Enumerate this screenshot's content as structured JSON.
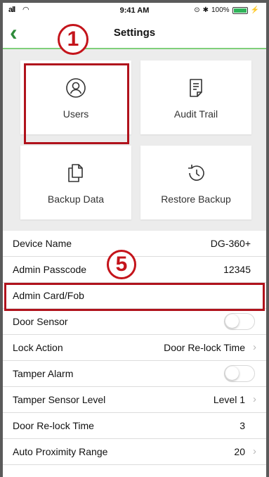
{
  "status": {
    "time": "9:41 AM",
    "signal": "all",
    "battery": "100%"
  },
  "nav": {
    "title": "Settings",
    "back_icon": "chevron-left-icon"
  },
  "annotations": {
    "one": "1",
    "five": "5"
  },
  "tiles": [
    {
      "label": "Users",
      "icon": "user-icon"
    },
    {
      "label": "Audit Trail",
      "icon": "document-icon"
    },
    {
      "label": "Backup Data",
      "icon": "copy-icon"
    },
    {
      "label": "Restore Backup",
      "icon": "restore-icon"
    }
  ],
  "settings": [
    {
      "label": "Device Name",
      "value": "DG-360+"
    },
    {
      "label": "Admin Passcode",
      "value": "12345"
    },
    {
      "label": "Admin Card/Fob",
      "value": ""
    },
    {
      "label": "Door Sensor",
      "toggle": false
    },
    {
      "label": "Lock Action",
      "value": "Door Re-lock Time"
    },
    {
      "label": "Tamper Alarm",
      "toggle": false
    },
    {
      "label": "Tamper Sensor Level",
      "value": "Level 1"
    },
    {
      "label": "Door Re-lock Time",
      "value": "3"
    },
    {
      "label": "Auto Proximity Range",
      "value": "20"
    }
  ],
  "colors": {
    "accent": "#2e8b3a",
    "nav_underline": "#7fcf7b",
    "highlight": "#b0121c",
    "annotation": "#c4141b"
  }
}
